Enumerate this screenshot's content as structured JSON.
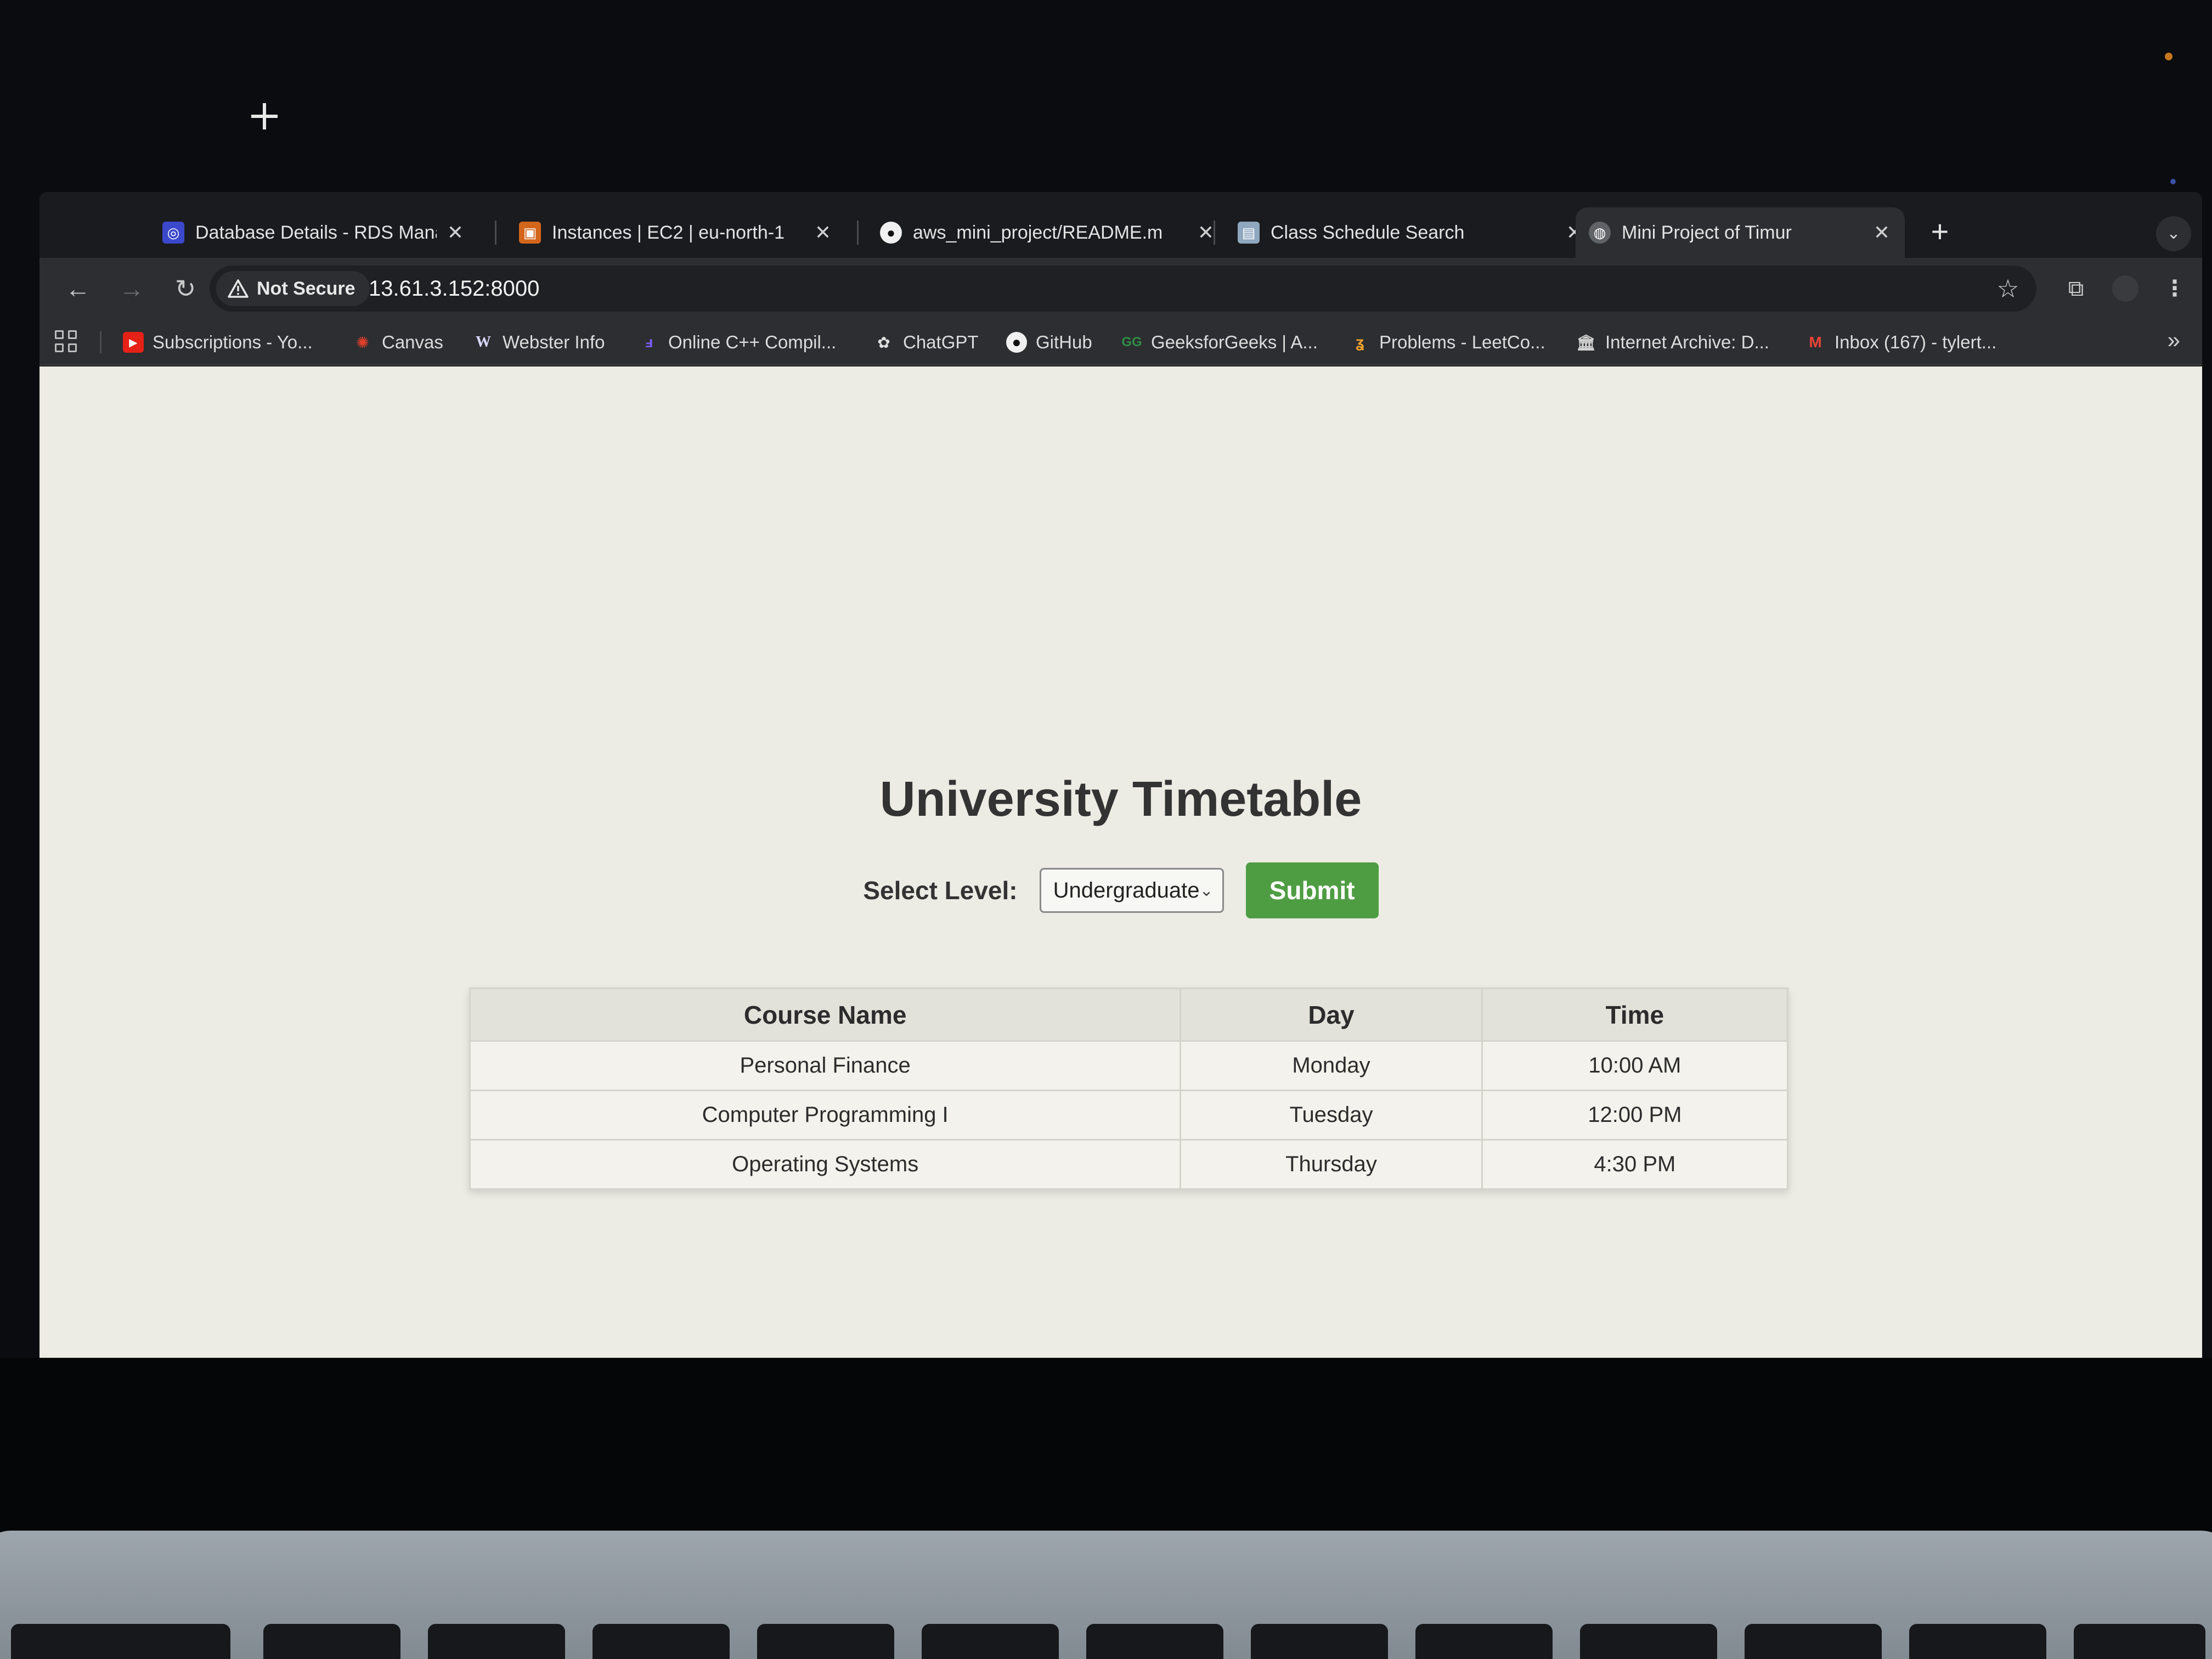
{
  "browser": {
    "tabs": [
      {
        "title": "Database Details - RDS Mana",
        "icon": "rds-icon",
        "active": false
      },
      {
        "title": "Instances | EC2 | eu-north-1",
        "icon": "ec2-icon",
        "active": false
      },
      {
        "title": "aws_mini_project/README.m",
        "icon": "github-icon",
        "active": false
      },
      {
        "title": "Class Schedule Search",
        "icon": "schedule-icon",
        "active": false
      },
      {
        "title": "Mini Project of Timur",
        "icon": "globe-icon",
        "active": true
      }
    ],
    "new_tab": "+",
    "security_label": "Not Secure",
    "url": "13.61.3.152:8000",
    "bookmarks": [
      {
        "label": "Subscriptions - Yo...",
        "icon": "youtube-icon"
      },
      {
        "label": "Canvas",
        "icon": "canvas-icon"
      },
      {
        "label": "Webster Info",
        "icon": "webster-icon"
      },
      {
        "label": "Online C++ Compil...",
        "icon": "compiler-icon"
      },
      {
        "label": "ChatGPT",
        "icon": "chatgpt-icon"
      },
      {
        "label": "GitHub",
        "icon": "github-icon"
      },
      {
        "label": "GeeksforGeeks | A...",
        "icon": "geeksforgeeks-icon"
      },
      {
        "label": "Problems - LeetCo...",
        "icon": "leetcode-icon"
      },
      {
        "label": "Internet Archive: D...",
        "icon": "archive-icon"
      },
      {
        "label": "Inbox (167) - tylert...",
        "icon": "gmail-icon"
      }
    ],
    "bookmarks_overflow": "»"
  },
  "page": {
    "title": "University Timetable",
    "select_label": "Select Level:",
    "select_value": "Undergraduate",
    "submit_label": "Submit",
    "table": {
      "headers": [
        "Course Name",
        "Day",
        "Time"
      ],
      "rows": [
        [
          "Personal Finance",
          "Monday",
          "10:00 AM"
        ],
        [
          "Computer Programming I",
          "Tuesday",
          "12:00 PM"
        ],
        [
          "Operating Systems",
          "Thursday",
          "4:30 PM"
        ]
      ]
    }
  },
  "colors": {
    "submit": "#4f9d43",
    "page_bg": "#ecebe4",
    "chrome_dark": "#2d2e31"
  }
}
